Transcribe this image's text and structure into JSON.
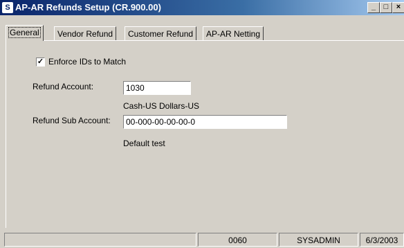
{
  "window": {
    "title": "AP-AR Refunds Setup (CR.900.00)"
  },
  "title_buttons": {
    "minimize": "_",
    "maximize": "□",
    "close": "×"
  },
  "tabs": [
    {
      "label": "General"
    },
    {
      "label": "Vendor Refund"
    },
    {
      "label": "Customer Refund"
    },
    {
      "label": "AP-AR Netting"
    }
  ],
  "general": {
    "enforce_ids_label": "Enforce IDs to Match",
    "enforce_ids_checked": true,
    "refund_account_label": "Refund Account:",
    "refund_account_value": "1030",
    "refund_account_desc": "Cash-US Dollars-US",
    "refund_sub_account_label": "Refund Sub Account:",
    "refund_sub_account_value": "00-000-00-00-00-0",
    "refund_sub_account_desc": "Default test"
  },
  "status_bar": {
    "message": "",
    "company": "0060",
    "user": "SYSADMIN",
    "date": "6/3/2003"
  }
}
